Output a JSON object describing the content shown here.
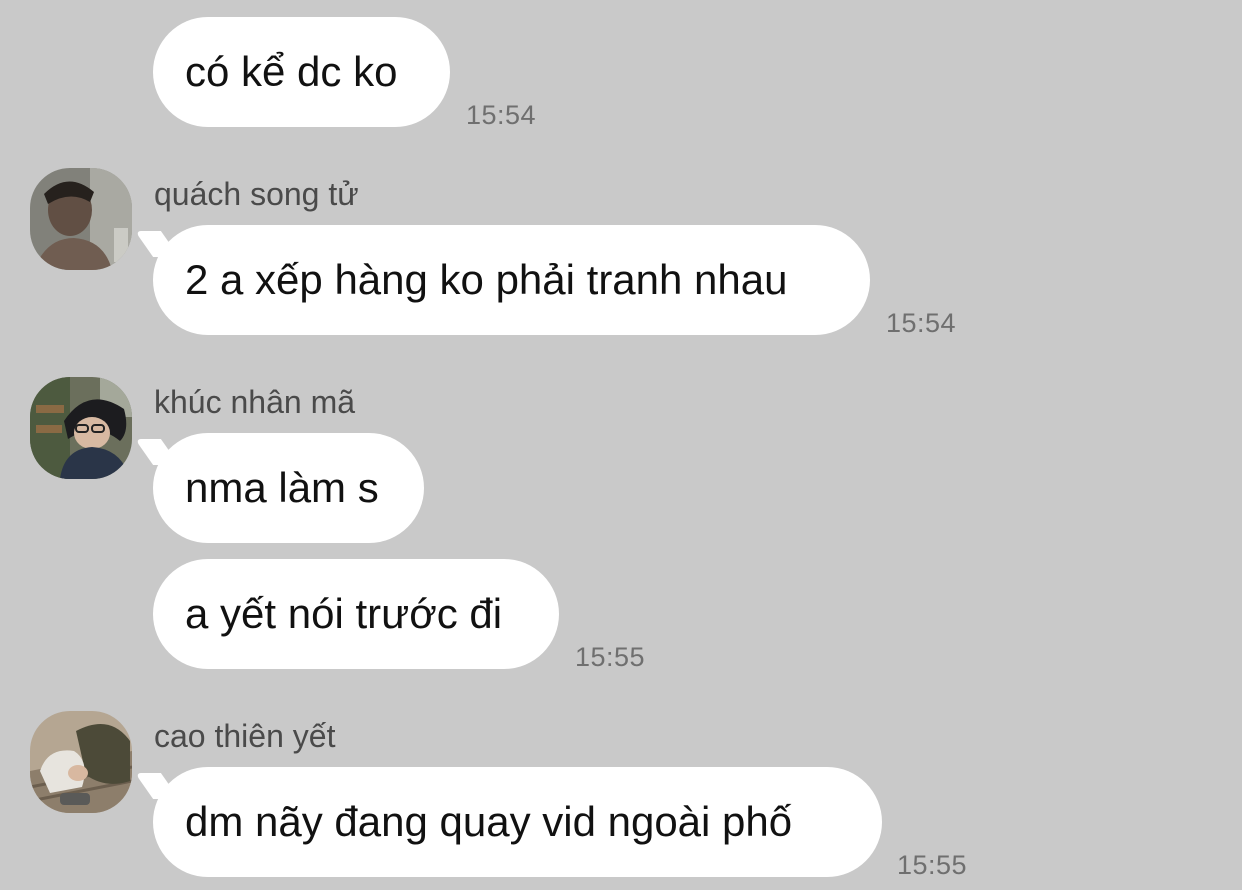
{
  "messages": [
    {
      "text": "có kể dc ko",
      "time": "15:54"
    },
    {
      "sender": "quách song tử",
      "avatar_icon": "user-avatar-photo",
      "text": "2 a xếp hàng ko phải tranh nhau",
      "time": "15:54"
    },
    {
      "sender": "khúc nhân mã",
      "avatar_icon": "user-avatar-photo",
      "text": "nma làm s"
    },
    {
      "text": "a yết nói trước đi",
      "time": "15:55"
    },
    {
      "sender": "cao thiên yết",
      "avatar_icon": "user-avatar-photo",
      "text": "dm nãy đang quay vid ngoài phố",
      "time": "15:55"
    }
  ],
  "colors": {
    "background": "#c9c9c9",
    "bubble": "#ffffff",
    "text": "#111111",
    "meta": "#6f6f6f"
  }
}
